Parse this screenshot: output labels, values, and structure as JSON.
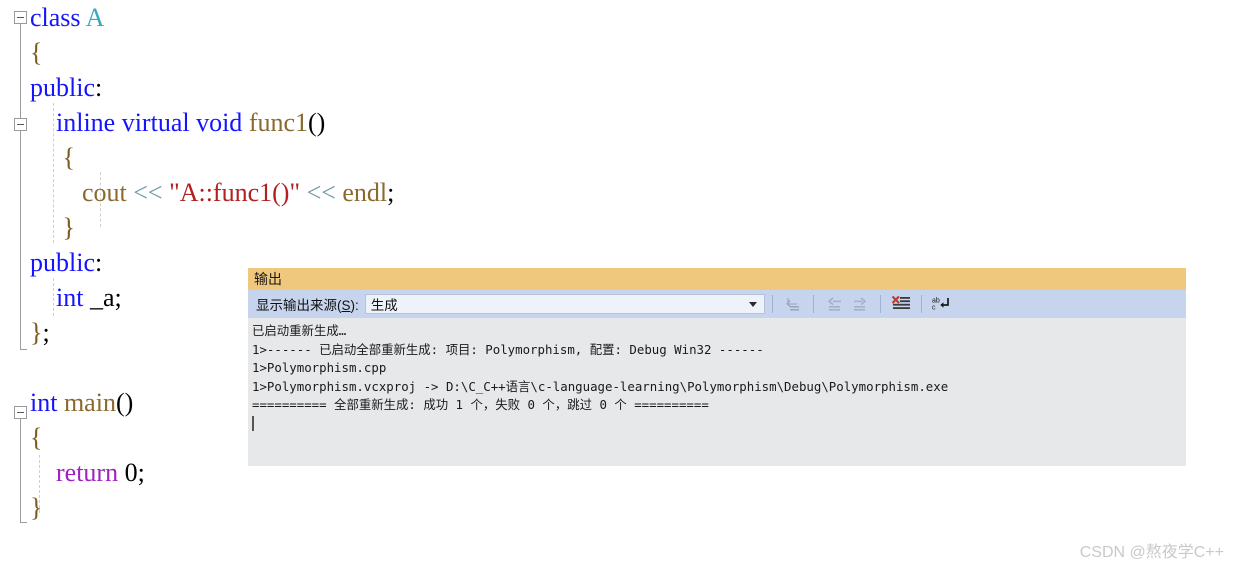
{
  "editor": {
    "lines": [
      {
        "indent": 0,
        "tokens": [
          {
            "t": "class ",
            "c": "kw"
          },
          {
            "t": "A",
            "c": "cls"
          }
        ]
      },
      {
        "indent": 0,
        "tokens": [
          {
            "t": "{",
            "c": "brace"
          }
        ]
      },
      {
        "indent": 0,
        "tokens": [
          {
            "t": "public",
            "c": "kw"
          },
          {
            "t": ":",
            "c": "pl"
          }
        ]
      },
      {
        "indent": 0,
        "tokens": [
          {
            "t": "    ",
            "c": "pl"
          },
          {
            "t": "inline virtual void ",
            "c": "kw"
          },
          {
            "t": "func1",
            "c": "fn"
          },
          {
            "t": "()",
            "c": "pl"
          }
        ]
      },
      {
        "indent": 0,
        "tokens": [
          {
            "t": "     ",
            "c": "pl"
          },
          {
            "t": "{",
            "c": "brace"
          }
        ]
      },
      {
        "indent": 0,
        "tokens": [
          {
            "t": "        ",
            "c": "pl"
          },
          {
            "t": "cout",
            "c": "fn"
          },
          {
            "t": " ",
            "c": "pl"
          },
          {
            "t": "<<",
            "c": "op"
          },
          {
            "t": " ",
            "c": "pl"
          },
          {
            "t": "\"A::func1()\"",
            "c": "str"
          },
          {
            "t": " ",
            "c": "pl"
          },
          {
            "t": "<<",
            "c": "op"
          },
          {
            "t": " ",
            "c": "pl"
          },
          {
            "t": "endl",
            "c": "fn"
          },
          {
            "t": ";",
            "c": "pl"
          }
        ]
      },
      {
        "indent": 0,
        "tokens": [
          {
            "t": "     ",
            "c": "pl"
          },
          {
            "t": "}",
            "c": "brace"
          }
        ]
      },
      {
        "indent": 0,
        "tokens": [
          {
            "t": "public",
            "c": "kw"
          },
          {
            "t": ":",
            "c": "pl"
          }
        ]
      },
      {
        "indent": 0,
        "tokens": [
          {
            "t": "    ",
            "c": "pl"
          },
          {
            "t": "int",
            "c": "kw"
          },
          {
            "t": " _a;",
            "c": "pl"
          }
        ]
      },
      {
        "indent": 0,
        "tokens": [
          {
            "t": "}",
            "c": "brace"
          },
          {
            "t": ";",
            "c": "pl"
          }
        ]
      },
      {
        "indent": 0,
        "tokens": []
      },
      {
        "indent": 0,
        "tokens": [
          {
            "t": "int ",
            "c": "kw"
          },
          {
            "t": "main",
            "c": "fn"
          },
          {
            "t": "()",
            "c": "pl"
          }
        ]
      },
      {
        "indent": 0,
        "tokens": [
          {
            "t": "{",
            "c": "brace"
          }
        ]
      },
      {
        "indent": 0,
        "tokens": [
          {
            "t": "    ",
            "c": "pl"
          },
          {
            "t": "return",
            "c": "ctl"
          },
          {
            "t": " ",
            "c": "pl"
          },
          {
            "t": "0",
            "c": "num"
          },
          {
            "t": ";",
            "c": "pl"
          }
        ]
      },
      {
        "indent": 0,
        "tokens": [
          {
            "t": "}",
            "c": "brace"
          }
        ]
      }
    ],
    "plain_text": "class A\n{\npublic:\n    inline virtual void func1()\n     {\n        cout << \"A::func1()\" << endl;\n     }\npublic:\n    int _a;\n};\n\nint main()\n{\n    return 0;\n}"
  },
  "output_panel": {
    "title": "输出",
    "toolbar": {
      "source_label_prefix": "显示输出来源(",
      "source_label_accel": "S",
      "source_label_suffix": "):",
      "source_value": "生成",
      "buttons": [
        {
          "name": "go-to-message-icon",
          "tooltip": "转到消息",
          "enabled": false
        },
        {
          "name": "previous-message-icon",
          "tooltip": "上一条消息",
          "enabled": false
        },
        {
          "name": "next-message-icon",
          "tooltip": "下一条消息",
          "enabled": false
        },
        {
          "name": "clear-all-icon",
          "tooltip": "全部清除",
          "enabled": true
        },
        {
          "name": "toggle-word-wrap-icon",
          "tooltip": "切换自动换行",
          "enabled": true
        }
      ]
    },
    "lines": [
      "已启动重新生成…",
      "1>------ 已启动全部重新生成: 项目: Polymorphism, 配置: Debug Win32 ------",
      "1>Polymorphism.cpp",
      "1>Polymorphism.vcxproj -> D:\\C_C++语言\\c-language-learning\\Polymorphism\\Debug\\Polymorphism.exe",
      "========== 全部重新生成: 成功 1 个，失败 0 个，跳过 0 个 =========="
    ]
  },
  "watermark": {
    "text": "CSDN @熬夜学C++"
  },
  "colors": {
    "title_bar": "#f0c87d",
    "toolbar": "#c7d4ee",
    "panel_body": "#e7e8ea",
    "keyword": "#1414ff",
    "class_name": "#3aa8c1",
    "function": "#8a6a2f",
    "string": "#b22020",
    "operator": "#6c9aa8",
    "control_keyword": "#a020c0",
    "clear_all_red": "#c0392b"
  }
}
